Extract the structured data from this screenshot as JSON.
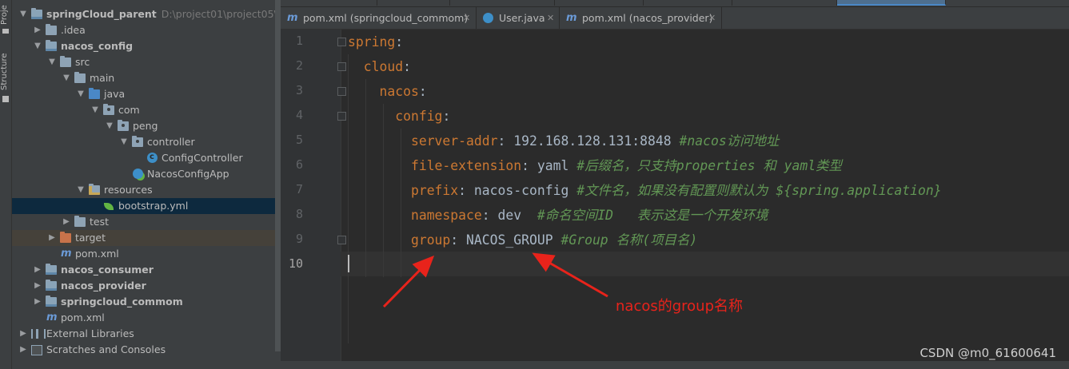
{
  "tool_strip": {
    "project_tab": "Proje",
    "structure_tab": "Structure"
  },
  "project_tree": [
    {
      "label": "springCloud_parent",
      "path": "D:\\project01\\project05\\sprin",
      "bold": true
    },
    {
      "label": ".idea"
    },
    {
      "label": "nacos_config",
      "bold": true
    },
    {
      "label": "src"
    },
    {
      "label": "main"
    },
    {
      "label": "java"
    },
    {
      "label": "com"
    },
    {
      "label": "peng"
    },
    {
      "label": "controller"
    },
    {
      "label": "ConfigController"
    },
    {
      "label": "NacosConfigApp"
    },
    {
      "label": "resources"
    },
    {
      "label": "bootstrap.yml"
    },
    {
      "label": "test"
    },
    {
      "label": "target"
    },
    {
      "label": "pom.xml"
    },
    {
      "label": "nacos_consumer",
      "bold": true
    },
    {
      "label": "nacos_provider",
      "bold": true
    },
    {
      "label": "springcloud_commom",
      "bold": true
    },
    {
      "label": "pom.xml"
    },
    {
      "label": "External Libraries"
    },
    {
      "label": "Scratches and Consoles"
    }
  ],
  "tabs": [
    {
      "label": "pom.xml (springcloud_commom)",
      "icon": "maven-icon"
    },
    {
      "label": "User.java",
      "icon": "class-icon"
    },
    {
      "label": "pom.xml (nacos_provider)",
      "icon": "maven-icon"
    }
  ],
  "editor": {
    "line_numbers": [
      "1",
      "2",
      "3",
      "4",
      "5",
      "6",
      "7",
      "8",
      "9",
      "10"
    ],
    "lines": [
      {
        "key": "spring",
        "sep": ":",
        "value": "",
        "comment": ""
      },
      {
        "key": "cloud",
        "sep": ":",
        "value": "",
        "comment": ""
      },
      {
        "key": "nacos",
        "sep": ":",
        "value": "",
        "comment": ""
      },
      {
        "key": "config",
        "sep": ":",
        "value": "",
        "comment": ""
      },
      {
        "key": "server-addr",
        "sep": ":",
        "value": " 192.168.128.131:8848 ",
        "comment": "#nacos访问地址"
      },
      {
        "key": "file-extension",
        "sep": ":",
        "value": " yaml ",
        "comment": "#后缀名，只支持properties 和 yaml类型"
      },
      {
        "key": "prefix",
        "sep": ":",
        "value": " nacos-config ",
        "comment": "#文件名，如果没有配置则默认为 ${spring.application}"
      },
      {
        "key": "namespace",
        "sep": ":",
        "value": " dev  ",
        "comment": "#命名空间ID   表示这是一个开发环境"
      },
      {
        "key": "group",
        "sep": ":",
        "value": " NACOS_GROUP ",
        "comment": "#Group 名称(项目名)"
      }
    ]
  },
  "annotation": {
    "text": "nacos的group名称",
    "color": "#e8231b"
  },
  "watermark": "CSDN @m0_61600641",
  "colors": {
    "yaml_key": "#cc7832",
    "comment": "#629755",
    "value": "#a9b7c6",
    "selected_row": "#0d293e"
  }
}
